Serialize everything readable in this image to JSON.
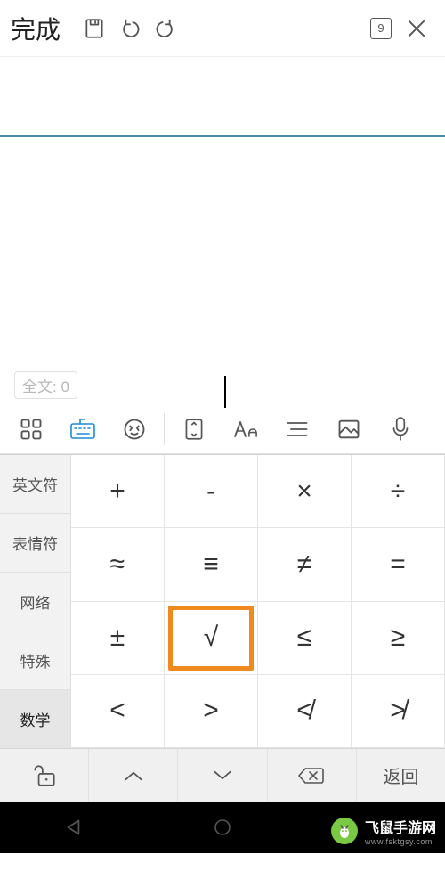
{
  "top_toolbar": {
    "done_label": "完成",
    "page_number": "9"
  },
  "editor": {
    "word_count_label": "全文: 0"
  },
  "symbol_keyboard": {
    "tabs": [
      {
        "label": "英文符",
        "active": false
      },
      {
        "label": "表情符",
        "active": false
      },
      {
        "label": "网络",
        "active": false
      },
      {
        "label": "特殊",
        "active": false
      },
      {
        "label": "数学",
        "active": true
      }
    ],
    "keys": [
      [
        "+",
        "-",
        "×",
        "÷"
      ],
      [
        "≈",
        "≡",
        "≠",
        "="
      ],
      [
        "±",
        "√",
        "≤",
        "≥"
      ],
      [
        "<",
        ">",
        "≮",
        "≯"
      ]
    ],
    "highlight": [
      2,
      1
    ],
    "bottom_row": {
      "return_label": "返回"
    }
  },
  "watermark": {
    "brand": "飞鼠手游网",
    "url": "www.fsktgsy.com"
  }
}
